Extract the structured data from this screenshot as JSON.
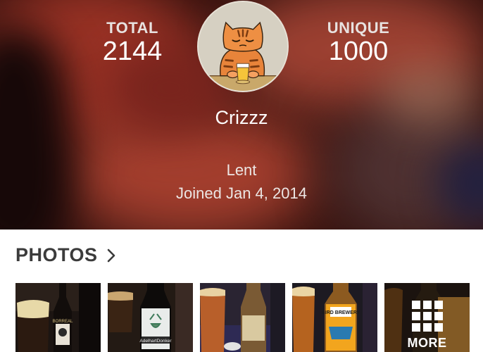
{
  "profile": {
    "total_label": "TOTAL",
    "total_value": "2144",
    "unique_label": "UNIQUE",
    "unique_value": "1000",
    "username": "Crizzz",
    "location": "Lent",
    "joined": "Joined Jan 4, 2014"
  },
  "photos": {
    "title": "PHOTOS",
    "more_label": "MORE",
    "thumb_labels": [
      "BORREAL",
      "AdelhartDonker",
      "",
      "BIRD BREWERY",
      ""
    ]
  },
  "colors": {
    "title_text": "#3b3b3b",
    "header_accent": "#b53b2b"
  },
  "icons": [
    "chevron-right-icon",
    "grid-icon",
    "avatar-cat-icon"
  ]
}
